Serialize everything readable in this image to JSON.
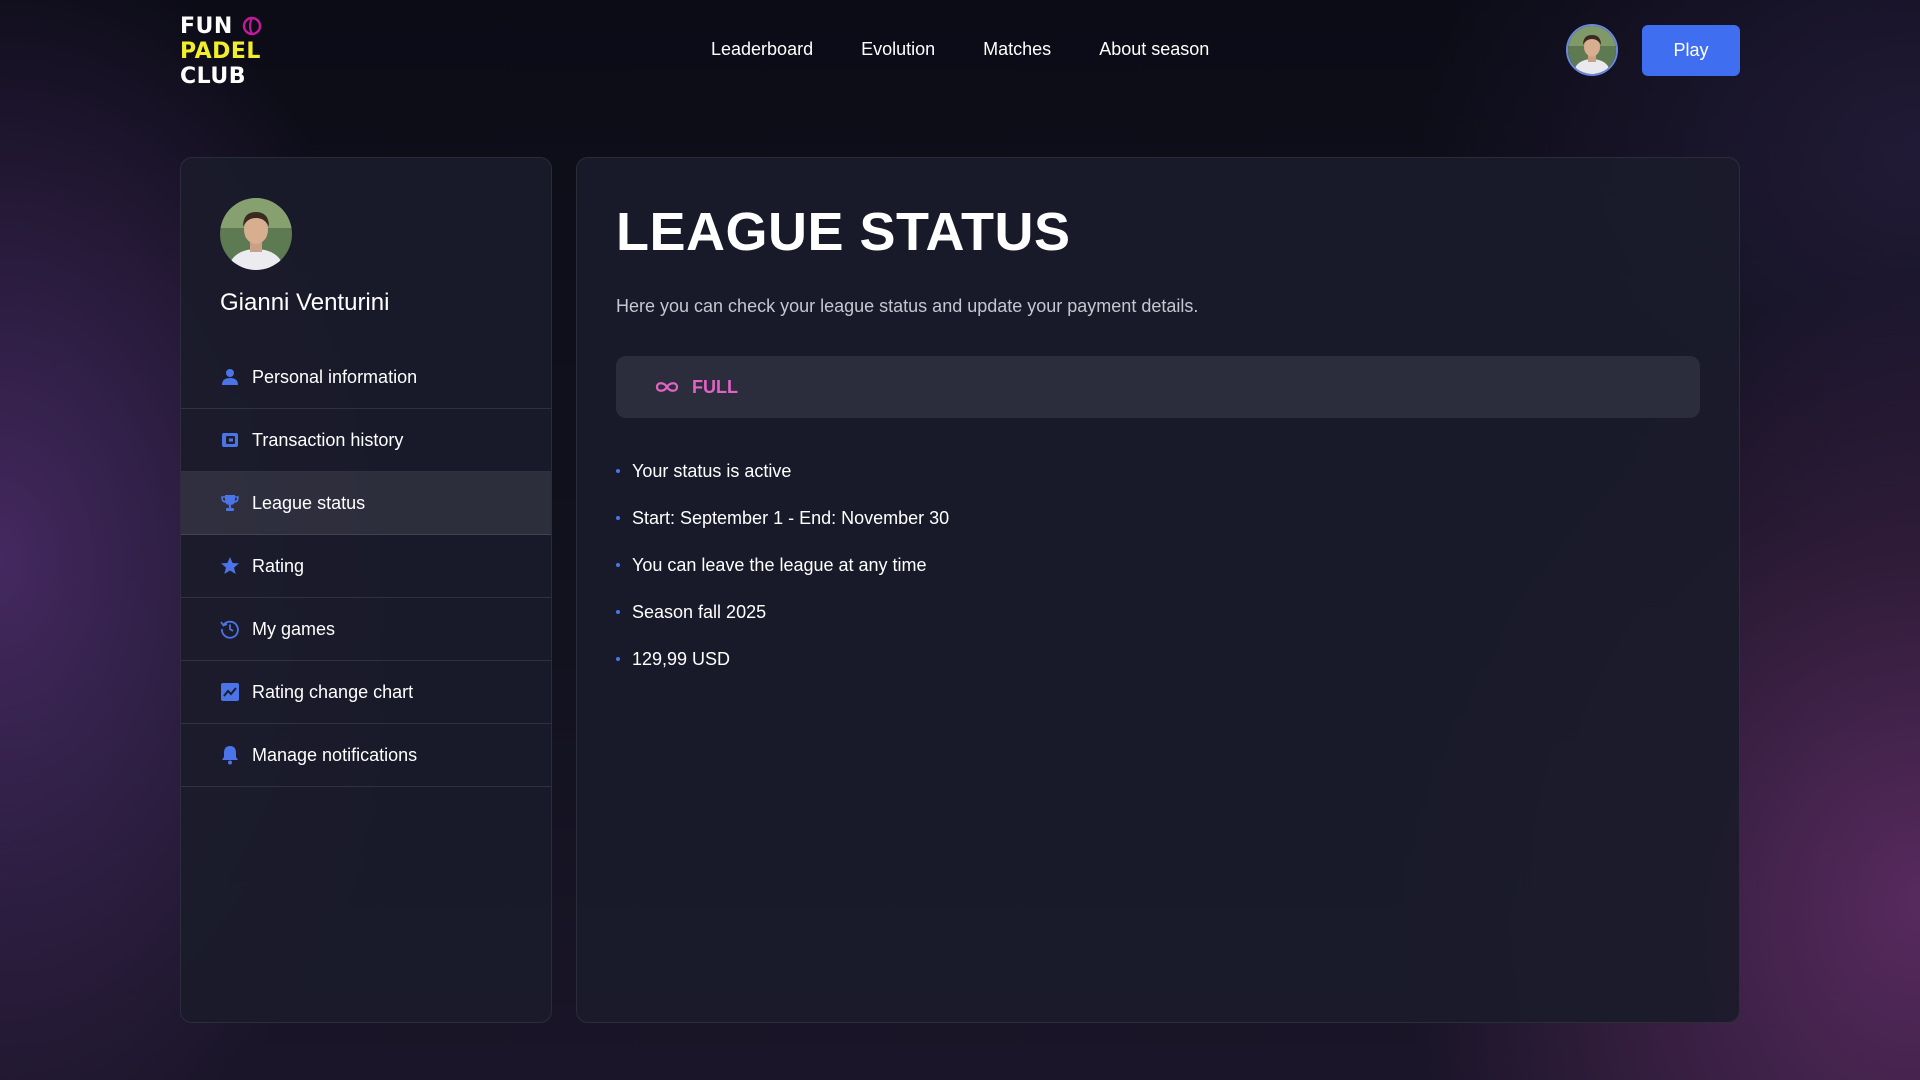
{
  "brand": {
    "line1": "FUN",
    "line2": "PADEL",
    "line3": "CLUB",
    "color_yellow": "#f2ee2a",
    "color_pink": "#c5199e"
  },
  "nav": {
    "items": [
      "Leaderboard",
      "Evolution",
      "Matches",
      "About season"
    ]
  },
  "header": {
    "avatar_icon": "user-avatar-photo",
    "play_label": "Play",
    "play_color": "#3f6ef0"
  },
  "sidebar": {
    "user_name": "Gianni Venturini",
    "items": [
      {
        "label": "Personal information",
        "icon": "person-icon",
        "active": false
      },
      {
        "label": "Transaction history",
        "icon": "wallet-icon",
        "active": false
      },
      {
        "label": "League status",
        "icon": "trophy-icon",
        "active": true
      },
      {
        "label": "Rating",
        "icon": "star-icon",
        "active": false
      },
      {
        "label": "My games",
        "icon": "history-icon",
        "active": false
      },
      {
        "label": "Rating change chart",
        "icon": "chart-icon",
        "active": false
      },
      {
        "label": "Manage notifications",
        "icon": "bell-icon",
        "active": false
      }
    ],
    "icon_color": "#4b74e8"
  },
  "main": {
    "title": "LEAGUE STATUS",
    "subtitle": "Here you can check your league status and update your payment details.",
    "plan": {
      "icon": "infinity-icon",
      "label": "FULL",
      "color": "#e163c4"
    },
    "details": [
      "Your status is active",
      "Start: September 1 - End: November 30",
      "You can leave the league at any time",
      "Season fall 2025",
      "129,99 USD"
    ]
  }
}
